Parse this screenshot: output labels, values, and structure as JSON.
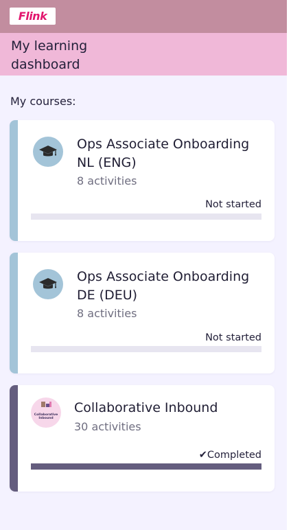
{
  "app": {
    "logo_text": "Flink"
  },
  "header": {
    "title": "My learning dashboard"
  },
  "courses_section": {
    "label": "My courses:"
  },
  "courses": [
    {
      "title": "Ops Associate Onboarding NL (ENG)",
      "activities": "8 activities",
      "status": "Not started",
      "progress": 0,
      "accent_color": "#a3c4d8",
      "icon": "graduation-cap-icon"
    },
    {
      "title": "Ops Associate Onboarding DE (DEU)",
      "activities": "8 activities",
      "status": "Not started",
      "progress": 0,
      "accent_color": "#a3c4d8",
      "icon": "graduation-cap-icon"
    },
    {
      "title": "Collaborative Inbound",
      "activities": "30 activities",
      "status": "✔Completed",
      "progress": 1,
      "accent_color": "#645d7e",
      "badge_text": "Collaborative Inbound"
    }
  ],
  "colors": {
    "topbar": "#c28d9f",
    "header": "#f0b8d8",
    "background": "#f4f2ff",
    "brand": "#e2166e",
    "progress_track": "#e7e5f0",
    "progress_fill": "#645d7e"
  }
}
